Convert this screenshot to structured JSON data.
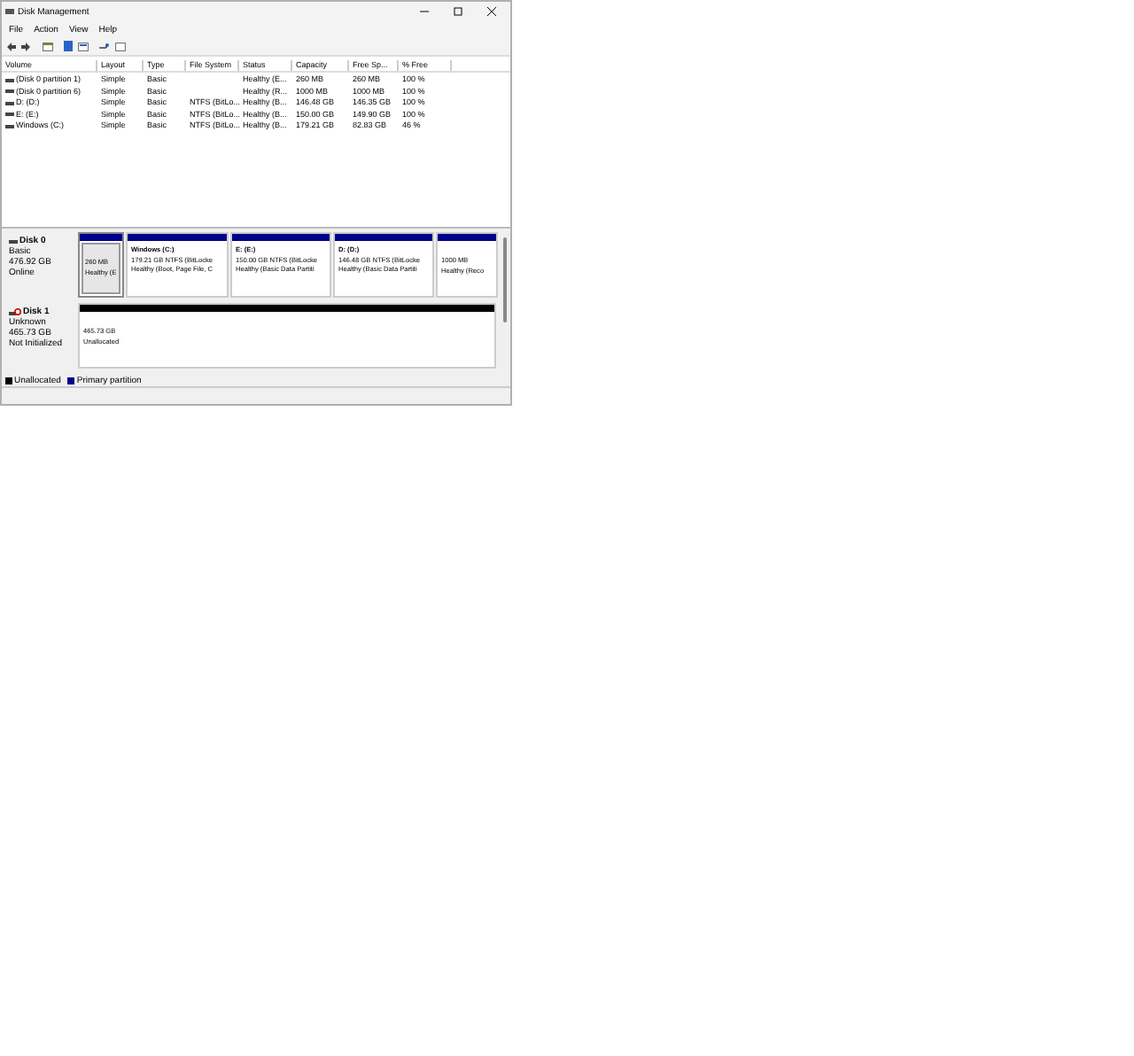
{
  "window": {
    "title": "Disk Management"
  },
  "menu": [
    "File",
    "Action",
    "View",
    "Help"
  ],
  "table": {
    "columns": [
      "Volume",
      "Layout",
      "Type",
      "File System",
      "Status",
      "Capacity",
      "Free Sp...",
      "% Free"
    ],
    "rows": [
      [
        "(Disk 0 partition 1)",
        "Simple",
        "Basic",
        "",
        "Healthy (E...",
        "260 MB",
        "260 MB",
        "100 %"
      ],
      [
        "(Disk 0 partition 6)",
        "Simple",
        "Basic",
        "",
        "Healthy (R...",
        "1000 MB",
        "1000 MB",
        "100 %"
      ],
      [
        "D: (D:)",
        "Simple",
        "Basic",
        "NTFS (BitLo...",
        "Healthy (B...",
        "146.48 GB",
        "146.35 GB",
        "100 %"
      ],
      [
        "E: (E:)",
        "Simple",
        "Basic",
        "NTFS (BitLo...",
        "Healthy (B...",
        "150.00 GB",
        "149.90 GB",
        "100 %"
      ],
      [
        "Windows (C:)",
        "Simple",
        "Basic",
        "NTFS (BitLo...",
        "Healthy (B...",
        "179.21 GB",
        "82.83 GB",
        "46 %"
      ]
    ]
  },
  "disks": [
    {
      "name": "Disk 0",
      "kind": "online",
      "info": [
        "Basic",
        "476.92 GB",
        "Online"
      ],
      "partitions": [
        {
          "kind": "primary",
          "selected": true,
          "lines": [
            "260 MB",
            "Healthy (E"
          ]
        },
        {
          "kind": "primary",
          "selected": false,
          "name": "Windows  (C:)",
          "lines": [
            "179.21 GB NTFS (BitLocke",
            "Healthy (Boot, Page File, C"
          ]
        },
        {
          "kind": "primary",
          "selected": false,
          "name": "E:  (E:)",
          "lines": [
            "150.00 GB NTFS (BitLocke",
            "Healthy (Basic Data Partiti"
          ]
        },
        {
          "kind": "primary",
          "selected": false,
          "name": "D:  (D:)",
          "lines": [
            "146.48 GB NTFS (BitLocke",
            "Healthy (Basic Data Partiti"
          ]
        },
        {
          "kind": "primary",
          "selected": false,
          "lines": [
            "1000 MB",
            "Healthy (Reco"
          ]
        }
      ]
    },
    {
      "name": "Disk 1",
      "kind": "uninitialized",
      "info": [
        "Unknown",
        "465.73 GB",
        "Not Initialized"
      ],
      "partitions": [
        {
          "kind": "unallocated",
          "selected": false,
          "lines": [
            "465.73 GB",
            "Unallocated"
          ]
        }
      ]
    }
  ],
  "legend": [
    {
      "label": "Unallocated",
      "color": "#000000"
    },
    {
      "label": "Primary partition",
      "color": "#00008b"
    }
  ]
}
